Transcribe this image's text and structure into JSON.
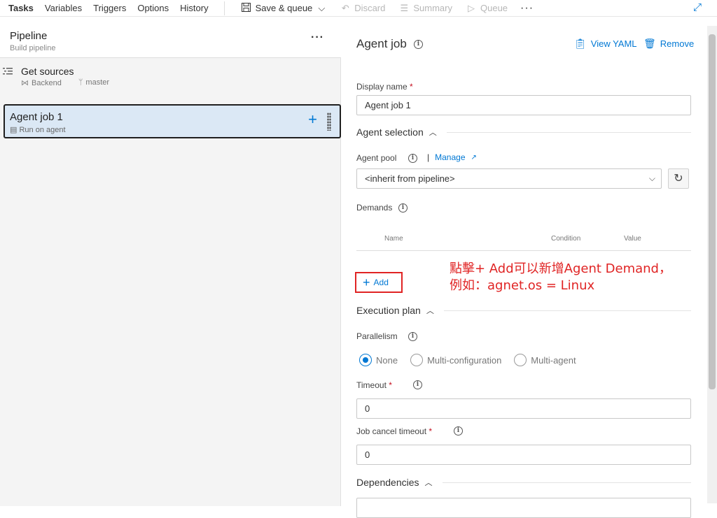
{
  "toolbar": {
    "tabs": [
      "Tasks",
      "Variables",
      "Triggers",
      "Options",
      "History"
    ],
    "save_queue": "Save & queue",
    "discard": "Discard",
    "summary": "Summary",
    "queue": "Queue",
    "more": "···"
  },
  "left": {
    "pipeline_title": "Pipeline",
    "pipeline_subtitle": "Build pipeline",
    "pipeline_more": "···",
    "sources_title": "Get sources",
    "sources_repo": "Backend",
    "sources_branch": "master",
    "job_title": "Agent job 1",
    "job_subtitle": "Run on agent"
  },
  "right": {
    "title": "Agent job",
    "view_yaml": "View YAML",
    "remove": "Remove",
    "display_name_label": "Display name",
    "display_name_value": "Agent job 1",
    "agent_selection": "Agent selection",
    "agent_pool_label": "Agent pool",
    "manage": "Manage",
    "agent_pool_value": "<inherit from pipeline>",
    "demands_label": "Demands",
    "demands_columns": [
      "Name",
      "Condition",
      "Value"
    ],
    "add_label": "Add",
    "annotation_line1": "點擊+ Add可以新增Agent Demand，",
    "annotation_line2": "例如：agnet.os = Linux",
    "execution_plan": "Execution plan",
    "parallelism_label": "Parallelism",
    "parallelism_options": [
      "None",
      "Multi-configuration",
      "Multi-agent"
    ],
    "parallelism_selected": "None",
    "timeout_label": "Timeout",
    "timeout_value": "0",
    "cancel_timeout_label": "Job cancel timeout",
    "cancel_timeout_value": "0",
    "dependencies": "Dependencies",
    "required_mark": "*"
  },
  "colors": {
    "accent": "#0078d4",
    "selected_job_bg": "#dbe8f5",
    "annotation_red": "#e02424"
  }
}
